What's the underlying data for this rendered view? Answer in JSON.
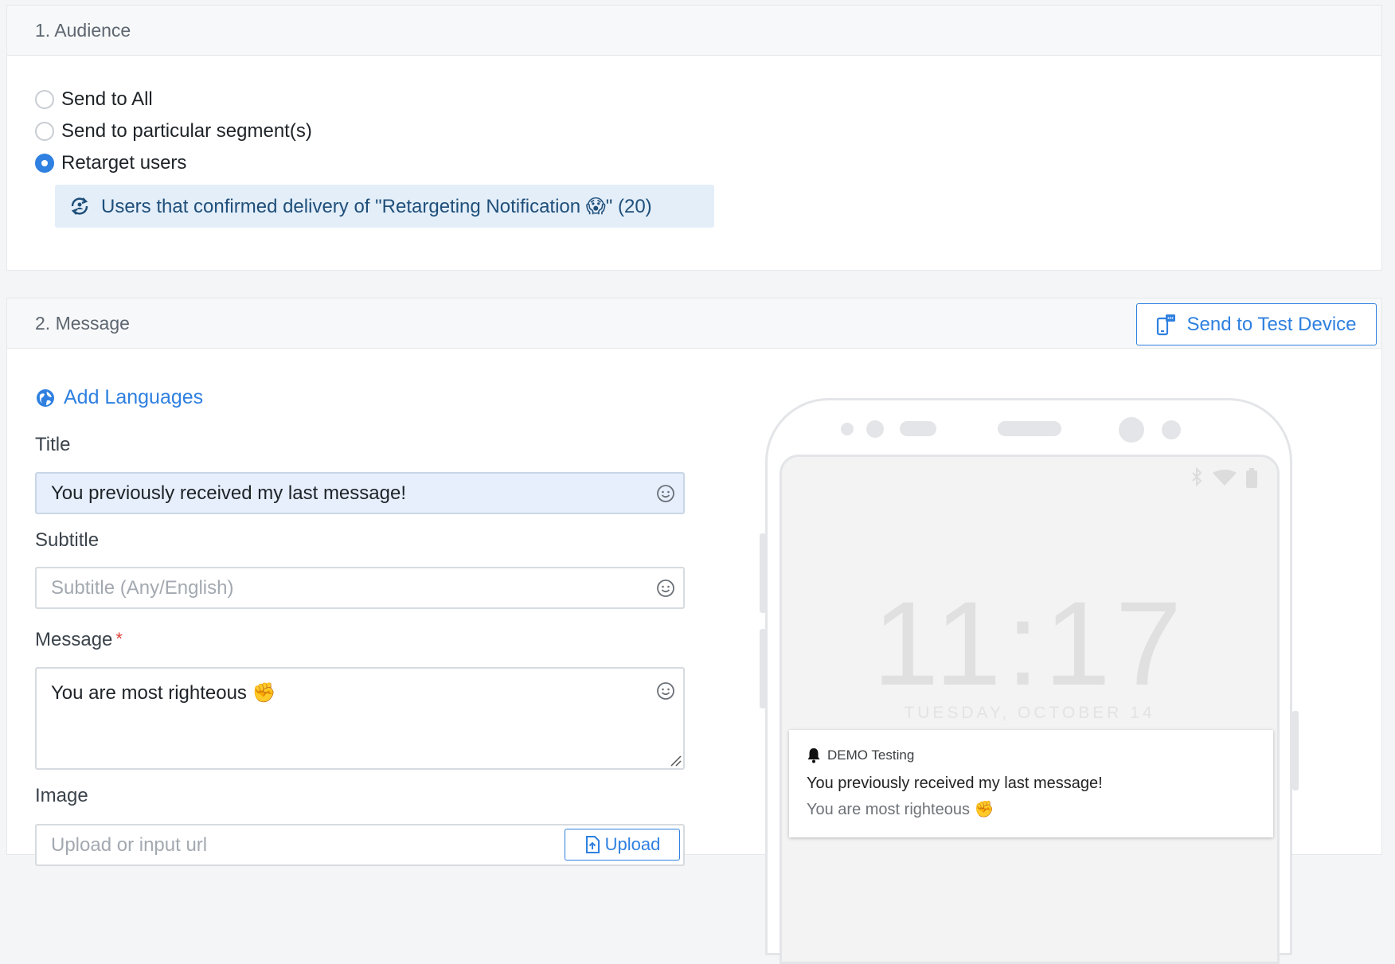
{
  "audience": {
    "title": "1. Audience",
    "options": [
      {
        "label": "Send to All",
        "checked": false
      },
      {
        "label": "Send to particular segment(s)",
        "checked": false
      },
      {
        "label": "Retarget users",
        "checked": true
      }
    ],
    "retarget_info": "Users that confirmed delivery of \"Retargeting Notification 😱\" (20)"
  },
  "message": {
    "title": "2. Message",
    "test_button_label": "Send to Test Device",
    "add_languages_label": "Add Languages",
    "fields": {
      "title_label": "Title",
      "title_value": "You previously received my last message!",
      "subtitle_label": "Subtitle",
      "subtitle_placeholder": "Subtitle (Any/English)",
      "message_label": "Message",
      "message_required_mark": "*",
      "message_value": "You are most righteous ✊",
      "image_label": "Image",
      "image_placeholder": "Upload or input url",
      "upload_label": "Upload"
    }
  },
  "preview": {
    "time": "11:17",
    "date": "TUESDAY, OCTOBER 14",
    "app_name": "DEMO Testing",
    "notification_title": "You previously received my last message!",
    "notification_body": "You are most righteous ✊"
  },
  "colors": {
    "accent": "#2f80e0",
    "retarget_bg": "#e3eef9",
    "required": "#e0403a"
  }
}
